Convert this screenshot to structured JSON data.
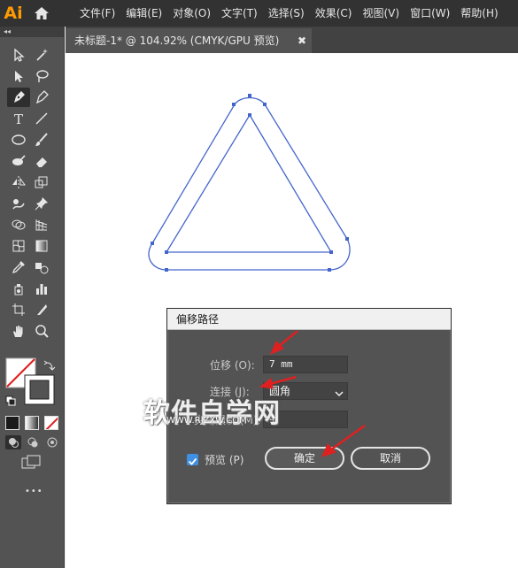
{
  "app": {
    "logo": "Ai"
  },
  "menu": [
    "文件(F)",
    "编辑(E)",
    "对象(O)",
    "文字(T)",
    "选择(S)",
    "效果(C)",
    "视图(V)",
    "窗口(W)",
    "帮助(H)"
  ],
  "toolbar": {
    "collapse_label": "◂◂",
    "more_label": "•••"
  },
  "tab": {
    "title": "未标题-1* @ 104.92% (CMYK/GPU 预览)",
    "close": "✖"
  },
  "dialog": {
    "title": "偏移路径",
    "offset_label": "位移 (O):",
    "offset_value": "7 mm",
    "join_label": "连接 (J):",
    "join_value": "圆角",
    "miter_label": "尖角限制 (M):",
    "miter_value": "4",
    "preview_label": "预览 (P)",
    "ok_label": "确定",
    "cancel_label": "取消"
  },
  "watermark": {
    "main": "软件自学网",
    "sub": "WWW.RJZXW.COM"
  },
  "colors": {
    "accent": "#3f8fe3",
    "path": "#4466cc",
    "arrow": "#e02020"
  }
}
